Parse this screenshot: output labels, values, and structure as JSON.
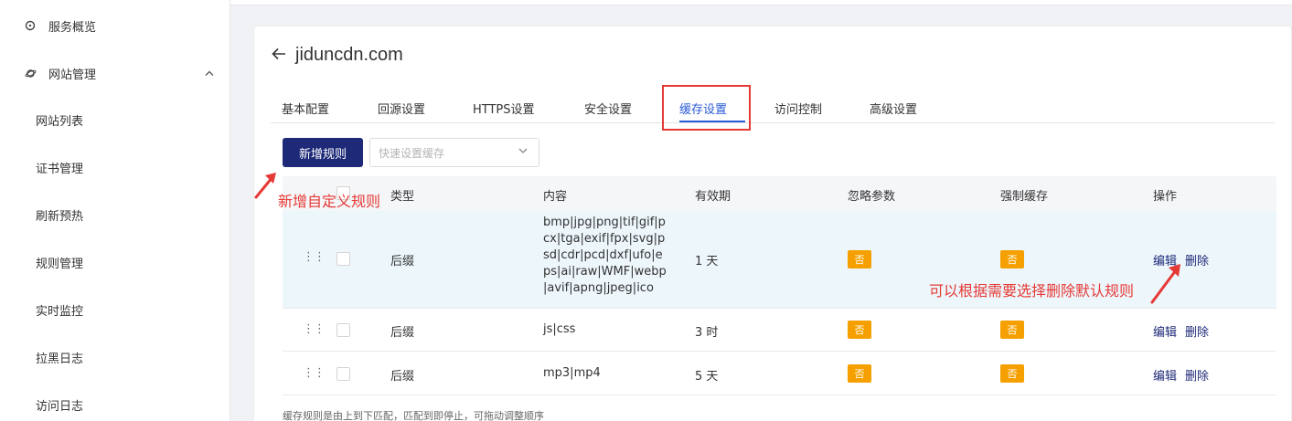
{
  "sidebar": {
    "overview_label": "服务概览",
    "site_mgmt_label": "网站管理",
    "sub_items": [
      "网站列表",
      "证书管理",
      "刷新预热",
      "规则管理",
      "实时监控",
      "拉黑日志",
      "访问日志"
    ]
  },
  "page": {
    "title": "jiduncdn.com"
  },
  "tabs": [
    "基本配置",
    "回源设置",
    "HTTPS设置",
    "安全设置",
    "缓存设置",
    "访问控制",
    "高级设置"
  ],
  "toolbar": {
    "add_rule_label": "新增规则",
    "quick_select_placeholder": "快速设置缓存"
  },
  "table": {
    "headers": [
      "类型",
      "内容",
      "有效期",
      "忽略参数",
      "强制缓存",
      "操作"
    ],
    "rows": [
      {
        "type": "后缀",
        "content": "bmp|jpg|png|tif|gif|pcx|tga|exif|fpx|svg|psd|cdr|pcd|dxf|ufo|eps|ai|raw|WMF|webp|avif|apng|jpeg|ico",
        "ttl": "1 天",
        "ignore": "否",
        "force": "否",
        "edit": "编辑",
        "delete": "删除"
      },
      {
        "type": "后缀",
        "content": "js|css",
        "ttl": "3 时",
        "ignore": "否",
        "force": "否",
        "edit": "编辑",
        "delete": "删除"
      },
      {
        "type": "后缀",
        "content": "mp3|mp4",
        "ttl": "5 天",
        "ignore": "否",
        "force": "否",
        "edit": "编辑",
        "delete": "删除"
      }
    ],
    "footer_note": "缓存规则是由上到下匹配，匹配到即停止，可拖动调整顺序"
  },
  "annotations": {
    "add_rule_note": "新增自定义规则",
    "delete_note": "可以根据需要选择删除默认规则"
  },
  "colors": {
    "primary": "#1e2a78",
    "tab_active": "#2a5bd7",
    "badge": "#f5a000",
    "annotation": "#e53935"
  }
}
